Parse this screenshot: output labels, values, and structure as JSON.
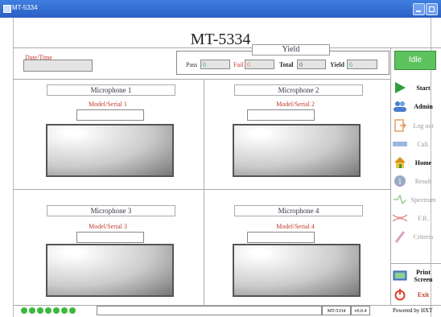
{
  "window": {
    "title": "MT-5334"
  },
  "header": {
    "title": "MT-5334"
  },
  "datetime": {
    "label": "Date/Time",
    "value": ""
  },
  "yield": {
    "title": "Yield",
    "pass_label": "Pass",
    "pass_value": "0",
    "fail_label": "Fail",
    "fail_value": "0",
    "total_label": "Total",
    "total_value": "0",
    "yield_label": "Yield",
    "yield_value": "0"
  },
  "status": {
    "label": "Idle",
    "color": "#5ec35e"
  },
  "microphones": [
    {
      "title": "Microphone 1",
      "model_label": "Model/Serial 1",
      "model_value": ""
    },
    {
      "title": "Microphone 2",
      "model_label": "Model/Serial 2",
      "model_value": ""
    },
    {
      "title": "Microphone 3",
      "model_label": "Model/Serial 3",
      "model_value": ""
    },
    {
      "title": "Microphone 4",
      "model_label": "Model/Serial 4",
      "model_value": ""
    }
  ],
  "sidebar": [
    {
      "label": "Start",
      "icon": "play-icon",
      "enabled": true
    },
    {
      "label": "Admin",
      "icon": "users-icon",
      "enabled": true
    },
    {
      "label": "Log out",
      "icon": "logout-icon",
      "enabled": false
    },
    {
      "label": "Cali.",
      "icon": "ruler-icon",
      "enabled": false
    },
    {
      "label": "Home",
      "icon": "home-icon",
      "enabled": true
    },
    {
      "label": "Result",
      "icon": "info-icon",
      "enabled": false
    },
    {
      "label": "Spectrum",
      "icon": "spectrum-icon",
      "enabled": false
    },
    {
      "label": "F.R.",
      "icon": "frequency-response-icon",
      "enabled": false
    },
    {
      "label": "Criteria",
      "icon": "criteria-icon",
      "enabled": false
    },
    {
      "label": "Print Screen",
      "icon": "print-screen-icon",
      "enabled": true
    },
    {
      "label": "Exit",
      "icon": "power-icon",
      "enabled": true
    }
  ],
  "statusbar": {
    "indicator_count": 7,
    "indicator_color": "#3cb83c",
    "model": "MT-5334",
    "version": "v0.0.4",
    "powered_by": "Powered by HXT"
  },
  "colors": {
    "label_red": "#c0392b",
    "titlebar_blue": "#2a5fc4"
  }
}
